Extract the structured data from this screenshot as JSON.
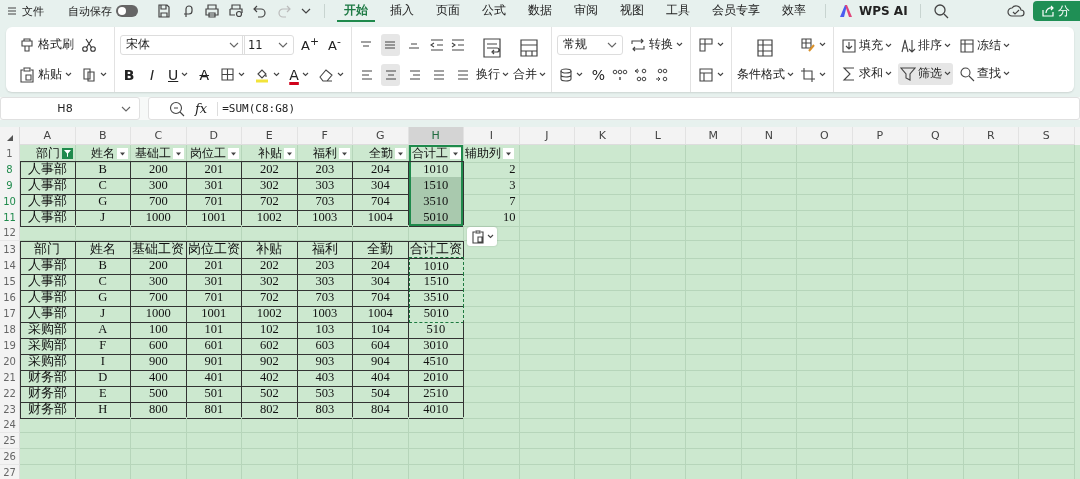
{
  "topbar": {
    "file": "文件",
    "autosave_label": "自动保存",
    "autosave_on": false,
    "redo_disabled": true,
    "tabs": [
      {
        "label": "开始",
        "selected": true
      },
      {
        "label": "插入",
        "selected": false
      },
      {
        "label": "页面",
        "selected": false
      },
      {
        "label": "公式",
        "selected": false
      },
      {
        "label": "数据",
        "selected": false
      },
      {
        "label": "审阅",
        "selected": false
      },
      {
        "label": "视图",
        "selected": false
      },
      {
        "label": "工具",
        "selected": false
      },
      {
        "label": "会员专享",
        "selected": false
      },
      {
        "label": "效率",
        "selected": false
      }
    ],
    "ai": "WPS AI",
    "share": "分"
  },
  "ribbon": {
    "format_painter": "格式刷",
    "paste": "粘贴",
    "font_name": "宋体",
    "font_size": "11",
    "grow_font": "A$^{+}$",
    "shrink_font": "A$^{-}$",
    "bold": "B",
    "italic": "I",
    "underline": "U",
    "strikethrough": "A",
    "font_color": "A",
    "vertical_align": [
      {
        "selected": false
      },
      {
        "selected": true
      },
      {
        "selected": false
      }
    ],
    "horizontal_align": [
      {
        "selected": false
      },
      {
        "selected": true
      },
      {
        "selected": false
      },
      {
        "selected": false
      },
      {
        "selected": false
      }
    ],
    "wrap": "换行",
    "merge": "合并",
    "number_format": "常规",
    "convert": "转换",
    "percent": "%",
    "conditional_format": "条件格式",
    "editing": [
      {
        "label": "填充",
        "selected": false
      },
      {
        "label": "排序",
        "selected": false
      },
      {
        "label": "冻结",
        "selected": false
      },
      {
        "label": "求和",
        "selected": false
      },
      {
        "label": "筛选",
        "selected": true
      },
      {
        "label": "查找",
        "selected": false
      }
    ]
  },
  "formula_bar": {
    "cell_ref": "H8",
    "fx": "fx",
    "formula": "=SUM(C8:G8)"
  },
  "sheet": {
    "columns": [
      {
        "letter": "A",
        "selected": false
      },
      {
        "letter": "B",
        "selected": false
      },
      {
        "letter": "C",
        "selected": false
      },
      {
        "letter": "D",
        "selected": false
      },
      {
        "letter": "E",
        "selected": false
      },
      {
        "letter": "F",
        "selected": false
      },
      {
        "letter": "G",
        "selected": false
      },
      {
        "letter": "H",
        "selected": true
      },
      {
        "letter": "I",
        "selected": false
      },
      {
        "letter": "J",
        "selected": false
      },
      {
        "letter": "K",
        "selected": false
      },
      {
        "letter": "L",
        "selected": false
      },
      {
        "letter": "M",
        "selected": false
      },
      {
        "letter": "N",
        "selected": false
      },
      {
        "letter": "O",
        "selected": false
      },
      {
        "letter": "P",
        "selected": false
      },
      {
        "letter": "Q",
        "selected": false
      },
      {
        "letter": "R",
        "selected": false
      },
      {
        "letter": "S",
        "selected": false
      }
    ],
    "rows": [
      {
        "number": "1",
        "filtered": false,
        "kind": "filter-header",
        "in_selection": true,
        "headers": [
          {
            "label": "部门",
            "filter_active": true
          },
          {
            "label": "姓名",
            "filter_active": false
          },
          {
            "label": "基础工",
            "filter_active": false
          },
          {
            "label": "岗位工",
            "filter_active": false
          },
          {
            "label": "补贴",
            "filter_active": false
          },
          {
            "label": "福利",
            "filter_active": false
          },
          {
            "label": "全勤",
            "filter_active": false
          },
          {
            "label": "合计工",
            "filter_active": false
          },
          {
            "label": "辅助列",
            "filter_active": false
          }
        ]
      },
      {
        "number": "8",
        "filtered": true,
        "kind": "data",
        "bordered": true,
        "cells": [
          "人事部",
          "B",
          "200",
          "201",
          "202",
          "203",
          "204"
        ],
        "total": {
          "text": "1010",
          "in_selection": true,
          "selected": false,
          "copied": false
        },
        "helper": "2"
      },
      {
        "number": "9",
        "filtered": true,
        "kind": "data",
        "bordered": true,
        "cells": [
          "人事部",
          "C",
          "300",
          "301",
          "302",
          "303",
          "304"
        ],
        "total": {
          "text": "1510",
          "in_selection": true,
          "selected": true,
          "copied": false
        },
        "helper": "3"
      },
      {
        "number": "10",
        "filtered": true,
        "kind": "data",
        "bordered": true,
        "cells": [
          "人事部",
          "G",
          "700",
          "701",
          "702",
          "703",
          "704"
        ],
        "total": {
          "text": "3510",
          "in_selection": true,
          "selected": true,
          "copied": false
        },
        "helper": "7"
      },
      {
        "number": "11",
        "filtered": true,
        "kind": "data",
        "bordered": true,
        "cells": [
          "人事部",
          "J",
          "1000",
          "1001",
          "1002",
          "1003",
          "1004"
        ],
        "total": {
          "text": "5010",
          "in_selection": true,
          "selected": true,
          "copied": false
        },
        "helper": "10"
      },
      {
        "number": "12",
        "filtered": false,
        "kind": "blank"
      },
      {
        "number": "13",
        "filtered": false,
        "kind": "data",
        "bordered": true,
        "cells": [
          "部门",
          "姓名",
          "基础工资",
          "岗位工资",
          "补贴",
          "福利",
          "全勤"
        ],
        "total": {
          "text": "合计工资",
          "in_selection": false,
          "selected": false,
          "copied": false
        }
      },
      {
        "number": "14",
        "filtered": false,
        "kind": "data",
        "bordered": true,
        "cells": [
          "人事部",
          "B",
          "200",
          "201",
          "202",
          "203",
          "204"
        ],
        "total": {
          "text": "1010",
          "in_selection": false,
          "selected": false,
          "copied": true
        }
      },
      {
        "number": "15",
        "filtered": false,
        "kind": "data",
        "bordered": true,
        "cells": [
          "人事部",
          "C",
          "300",
          "301",
          "302",
          "303",
          "304"
        ],
        "total": {
          "text": "1510",
          "in_selection": false,
          "selected": false,
          "copied": true
        }
      },
      {
        "number": "16",
        "filtered": false,
        "kind": "data",
        "bordered": true,
        "cells": [
          "人事部",
          "G",
          "700",
          "701",
          "702",
          "703",
          "704"
        ],
        "total": {
          "text": "3510",
          "in_selection": false,
          "selected": false,
          "copied": true
        }
      },
      {
        "number": "17",
        "filtered": false,
        "kind": "data",
        "bordered": true,
        "cells": [
          "人事部",
          "J",
          "1000",
          "1001",
          "1002",
          "1003",
          "1004"
        ],
        "total": {
          "text": "5010",
          "in_selection": false,
          "selected": false,
          "copied": true
        }
      },
      {
        "number": "18",
        "filtered": false,
        "kind": "data",
        "bordered": true,
        "cells": [
          "采购部",
          "A",
          "100",
          "101",
          "102",
          "103",
          "104"
        ],
        "total": {
          "text": "510",
          "in_selection": false,
          "selected": false,
          "copied": false
        }
      },
      {
        "number": "19",
        "filtered": false,
        "kind": "data",
        "bordered": true,
        "cells": [
          "采购部",
          "F",
          "600",
          "601",
          "602",
          "603",
          "604"
        ],
        "total": {
          "text": "3010",
          "in_selection": false,
          "selected": false,
          "copied": false
        }
      },
      {
        "number": "20",
        "filtered": false,
        "kind": "data",
        "bordered": true,
        "cells": [
          "采购部",
          "I",
          "900",
          "901",
          "902",
          "903",
          "904"
        ],
        "total": {
          "text": "4510",
          "in_selection": false,
          "selected": false,
          "copied": false
        }
      },
      {
        "number": "21",
        "filtered": false,
        "kind": "data",
        "bordered": true,
        "cells": [
          "财务部",
          "D",
          "400",
          "401",
          "402",
          "403",
          "404"
        ],
        "total": {
          "text": "2010",
          "in_selection": false,
          "selected": false,
          "copied": false
        }
      },
      {
        "number": "22",
        "filtered": false,
        "kind": "data",
        "bordered": true,
        "cells": [
          "财务部",
          "E",
          "500",
          "501",
          "502",
          "503",
          "504"
        ],
        "total": {
          "text": "2510",
          "in_selection": false,
          "selected": false,
          "copied": false
        }
      },
      {
        "number": "23",
        "filtered": false,
        "kind": "data",
        "bordered": true,
        "cells": [
          "财务部",
          "H",
          "800",
          "801",
          "802",
          "803",
          "804"
        ],
        "total": {
          "text": "4010",
          "in_selection": false,
          "selected": false,
          "copied": false
        }
      },
      {
        "number": "24",
        "filtered": false,
        "kind": "blank"
      },
      {
        "number": "25",
        "filtered": false,
        "kind": "blank"
      },
      {
        "number": "26",
        "filtered": false,
        "kind": "blank"
      },
      {
        "number": "27",
        "filtered": false,
        "kind": "blank"
      }
    ]
  }
}
